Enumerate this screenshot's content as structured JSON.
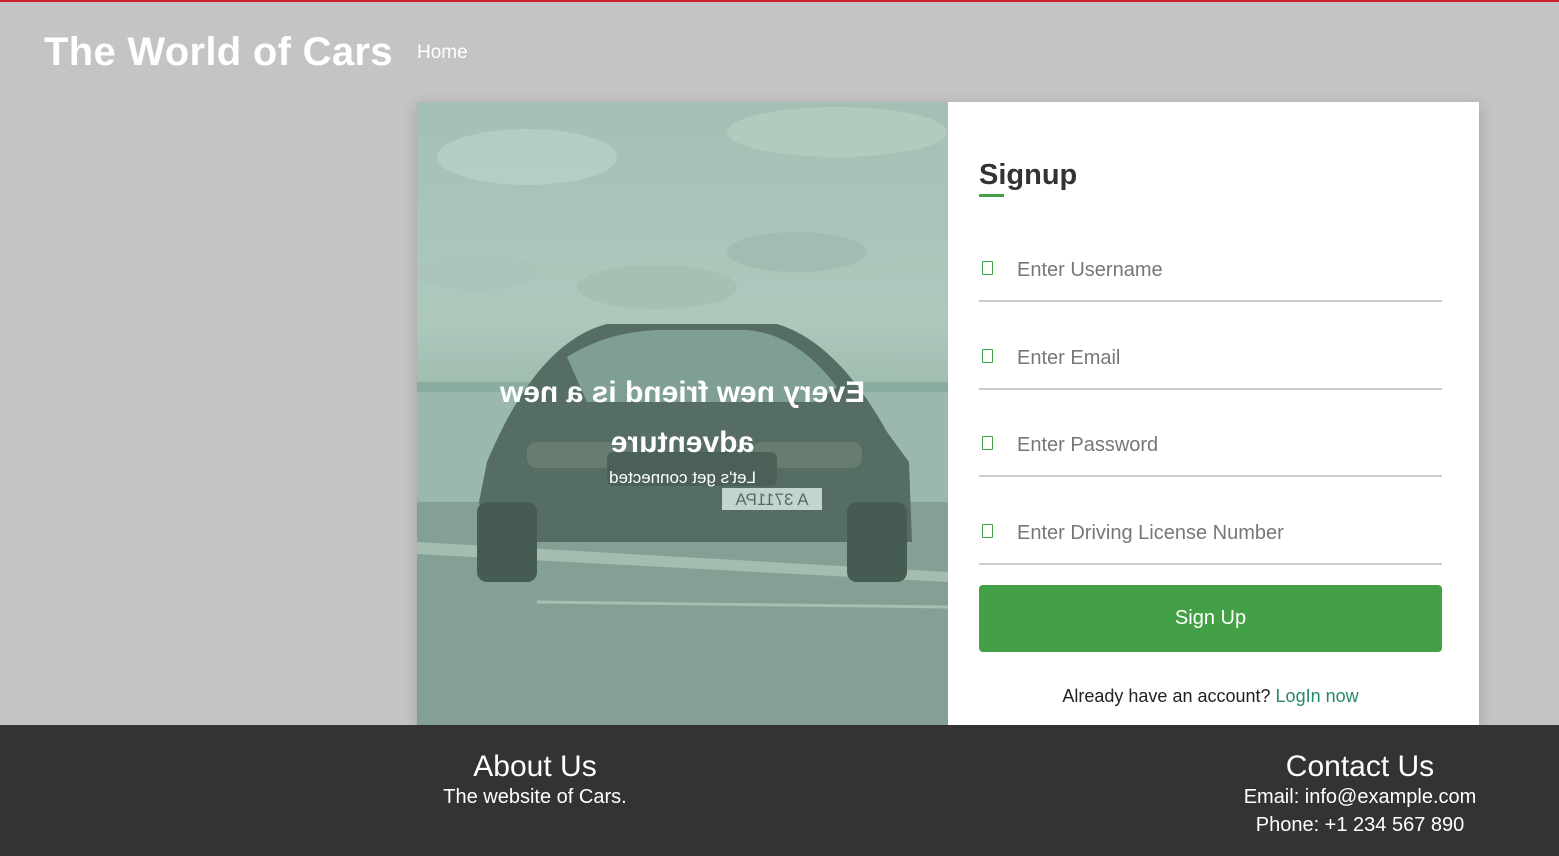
{
  "header": {
    "brand": "The World of Cars",
    "nav": {
      "home_label": "Home"
    }
  },
  "hero": {
    "title": "Every new friend is a new adventure",
    "subtitle": "Let's get connected",
    "plate_text": "A 3711PA"
  },
  "signup_form": {
    "title": "Signup",
    "fields": {
      "username": {
        "placeholder": "Enter Username",
        "icon": "user-icon"
      },
      "email": {
        "placeholder": "Enter Email",
        "icon": "envelope-icon"
      },
      "password": {
        "placeholder": "Enter Password",
        "icon": "lock-icon"
      },
      "license": {
        "placeholder": "Enter Driving License Number",
        "icon": "id-card-icon"
      }
    },
    "submit_label": "Sign Up",
    "login_prompt": "Already have an account?",
    "login_link_label": "LogIn now"
  },
  "footer": {
    "about": {
      "title": "About Us",
      "text": "The website of Cars."
    },
    "contact": {
      "title": "Contact Us",
      "email": "Email: info@example.com",
      "phone": "Phone: +1 234 567 890"
    }
  },
  "colors": {
    "accent": "#43a047",
    "link": "#26876d",
    "background": "#c4c4c4",
    "footer": "#333333",
    "top_border": "#c8232c"
  }
}
